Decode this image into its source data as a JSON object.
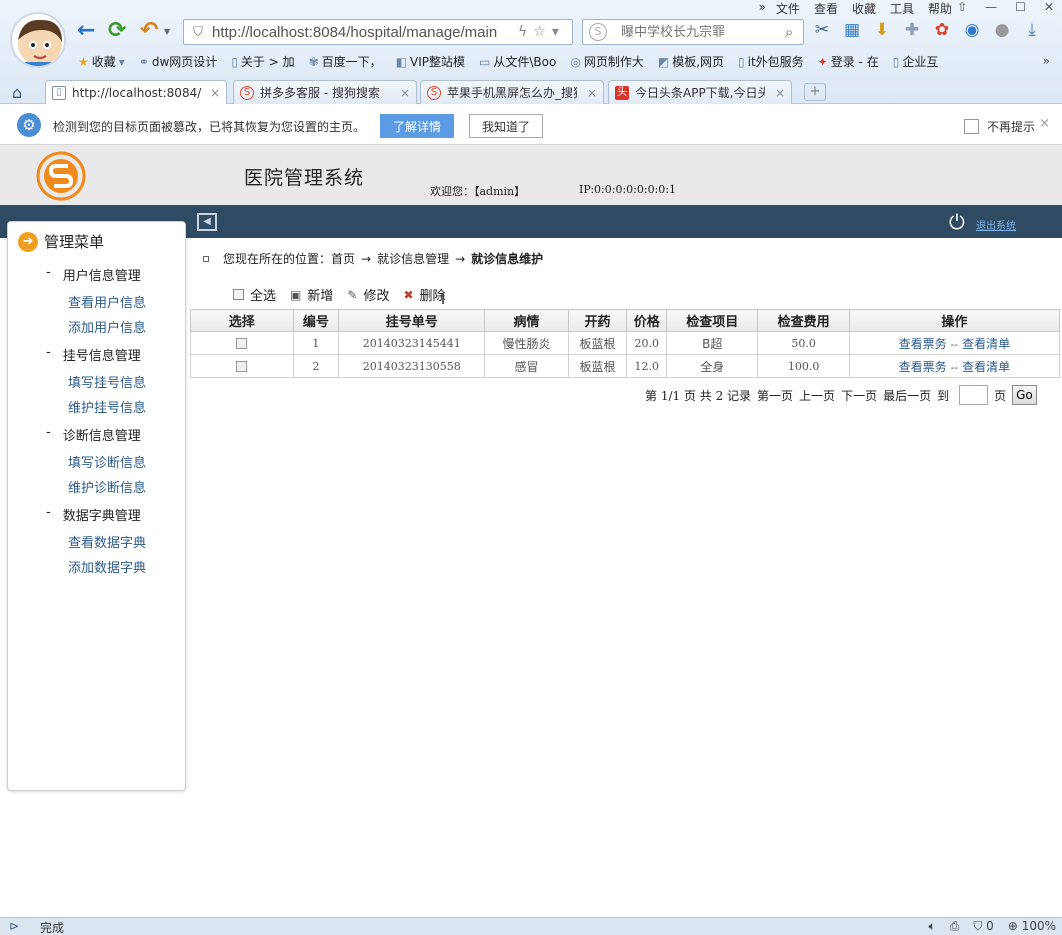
{
  "browser": {
    "menu": [
      "文件",
      "查看",
      "收藏",
      "工具",
      "帮助"
    ],
    "menu_more": "»",
    "url": "http://localhost:8084/hospital/manage/main",
    "search_placeholder": "曝中学校长九宗罪",
    "favorites_label": "收藏",
    "favorites": [
      "dw网页设计",
      "关于 > 加",
      "百度一下，",
      "VIP整站模",
      "从文件\\Boo",
      "网页制作大",
      "模板,网页",
      "it外包服务",
      "登录 - 在",
      "企业互"
    ],
    "tabs": [
      {
        "label": "http://localhost:8084/h",
        "active": true
      },
      {
        "label": "拼多多客服 - 搜狗搜索",
        "active": false
      },
      {
        "label": "苹果手机黑屏怎么办_搜狗",
        "active": false
      },
      {
        "label": "今日头条APP下载,今日头条",
        "active": false
      }
    ],
    "new_tab": "+",
    "status_text": "完成",
    "status_counter": "0",
    "zoom": "100%"
  },
  "notify": {
    "text": "检测到您的目标页面被篡改，已将其恢复为您设置的主页。",
    "learn_more": "了解详情",
    "ok": "我知道了",
    "no_more": "不再提示",
    "close": "×"
  },
  "app": {
    "title": "医院管理系统",
    "welcome": "欢迎您：【admin】",
    "ip": "IP:0:0:0:0:0:0:0:1",
    "logout": "退出系统",
    "menu_title": "管理菜单",
    "groups": [
      {
        "label": "用户信息管理",
        "items": [
          "查看用户信息",
          "添加用户信息"
        ]
      },
      {
        "label": "挂号信息管理",
        "items": [
          "填写挂号信息",
          "维护挂号信息"
        ]
      },
      {
        "label": "诊断信息管理",
        "items": [
          "填写诊断信息",
          "维护诊断信息"
        ]
      },
      {
        "label": "数据字典管理",
        "items": [
          "查看数据字典",
          "添加数据字典"
        ]
      }
    ],
    "group_dash": "-",
    "breadcrumb": {
      "prefix": "您现在所在的位置：",
      "home": "首页",
      "arrow": "→",
      "mid": "就诊信息管理",
      "current": "就诊信息维护"
    },
    "toolbar": {
      "select_all": "全选",
      "add": "新增",
      "edit": "修改",
      "delete": "删除"
    },
    "table": {
      "headers": [
        "选择",
        "编号",
        "挂号单号",
        "病情",
        "开药",
        "价格",
        "检查项目",
        "检查费用",
        "操作"
      ],
      "rows": [
        {
          "id": "1",
          "reg_no": "20140323145441",
          "condition": "慢性肠炎",
          "medicine": "板蓝根",
          "price": "20.0",
          "exam": "B超",
          "exam_fee": "50.0",
          "op1": "查看票务",
          "sep": "--",
          "op2": "查看清单"
        },
        {
          "id": "2",
          "reg_no": "20140323130558",
          "condition": "感冒",
          "medicine": "板蓝根",
          "price": "12.0",
          "exam": "全身",
          "exam_fee": "100.0",
          "op1": "查看票务",
          "sep": "--",
          "op2": "查看清单"
        }
      ]
    },
    "pager": {
      "page_info": "第 1/1 页 共 2 记录",
      "first": "第一页",
      "prev": "上一页",
      "next": "下一页",
      "last": "最后一页",
      "to": "到",
      "page_unit": "页",
      "go": "Go"
    }
  }
}
